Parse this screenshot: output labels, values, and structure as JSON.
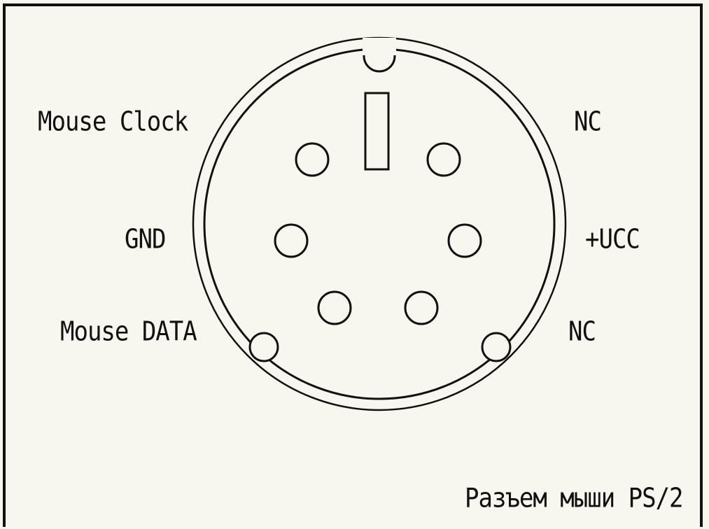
{
  "labels": {
    "mouse_clock": "Mouse Clock",
    "gnd": "GND",
    "mouse_data": "Mouse DATA",
    "nc_top": "NC",
    "vcc": "+UCC",
    "nc_bottom": "NC"
  },
  "caption": "Разъем мыши PS/2"
}
